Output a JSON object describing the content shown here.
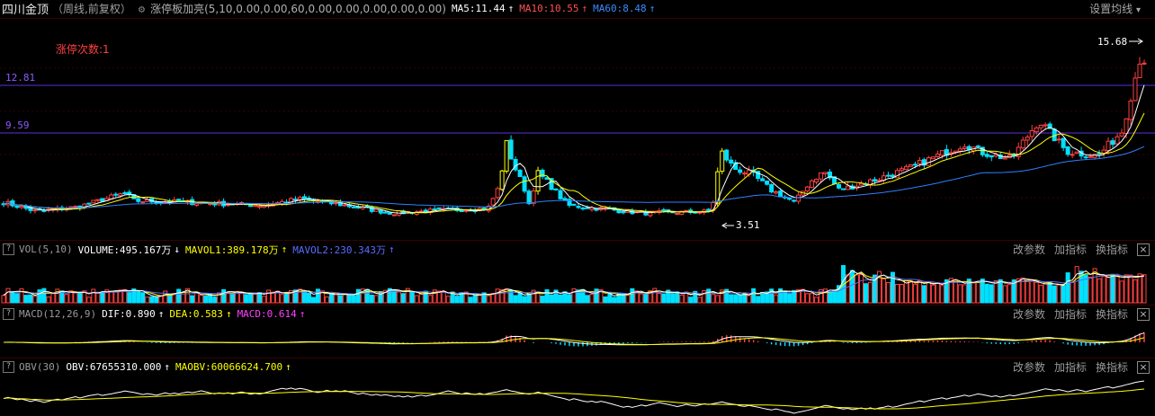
{
  "header": {
    "stock_name": "四川金顶",
    "period": "（周线,前复权）",
    "indicator": "涨停板加亮(5,10,0.00,0.00,60,0.00,0.00,0.00,0.00,0.00)",
    "ma5": "MA5:11.44",
    "ma10": "MA10:10.55",
    "ma60": "MA60:8.48",
    "settings": "设置均线"
  },
  "price_panel": {
    "limit_up_count": "涨停次数:1",
    "level_high": "12.81",
    "level_low": "9.59",
    "max_label": "15.68",
    "min_label": "3.51",
    "colors": {
      "up": "#ff4040",
      "down": "#00e0ff",
      "limit_up": "#ffff00",
      "ma5": "#ffffff",
      "ma10": "#ffff00",
      "ma60": "#2f7fff",
      "level": "#7b3cff"
    }
  },
  "vol_panel": {
    "name": "VOL(5,10)",
    "volume": "VOLUME:495.167万",
    "mavol1": "MAVOL1:389.178万",
    "mavol2": "MAVOL2:230.343万"
  },
  "macd_panel": {
    "name": "MACD(12,26,9)",
    "dif": "DIF:0.890",
    "dea": "DEA:0.583",
    "macd": "MACD:0.614"
  },
  "obv_panel": {
    "name": "OBV(30)",
    "obv": "OBV:67655310.000",
    "maobv": "MAOBV:60066624.700"
  },
  "tools": {
    "change_params": "改参数",
    "add_indicator": "加指标",
    "switch_indicator": "换指标",
    "help": "?",
    "close": "×"
  },
  "icons": {
    "gear": "gear-icon",
    "up_arrow": "↑",
    "down_arrow": "↓",
    "caret": "▾"
  }
}
